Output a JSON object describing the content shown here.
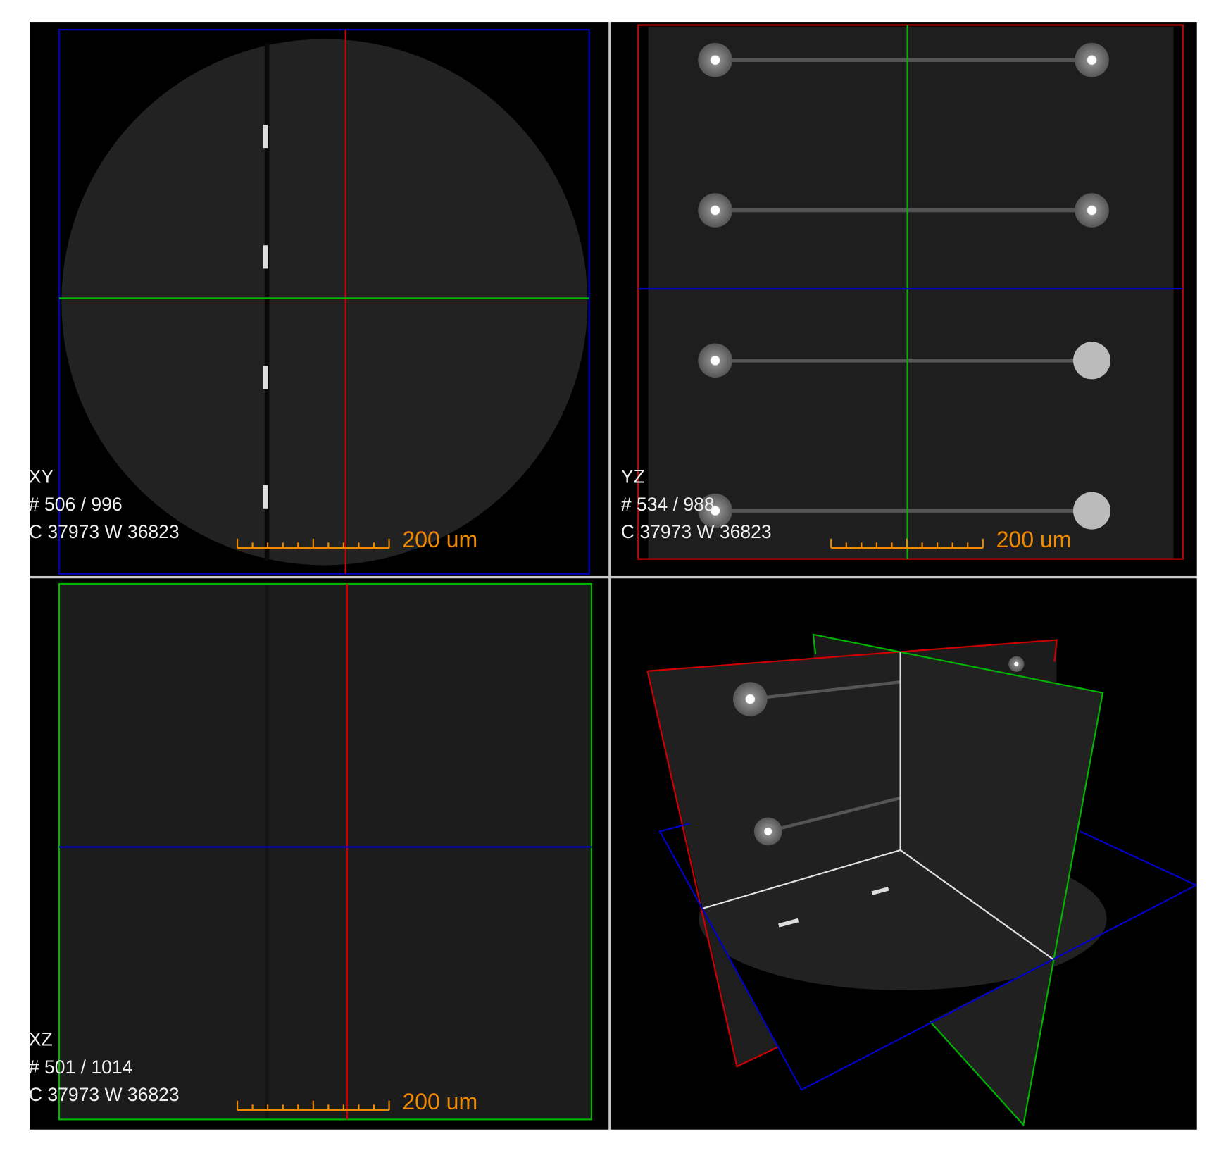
{
  "colors": {
    "x_plane": "#0000c8",
    "y_plane": "#cc0000",
    "z_plane": "#00b400",
    "scale": "#f08a00",
    "text": "#f0f0f0"
  },
  "views": {
    "xy": {
      "name": "XY",
      "slice": "# 506 / 996",
      "window": "C 37973 W 36823",
      "scale": "200 um"
    },
    "yz": {
      "name": "YZ",
      "slice": "# 534 / 988",
      "window": "C 37973 W 36823",
      "scale": "200 um"
    },
    "xz": {
      "name": "XZ",
      "slice": "# 501 / 1014",
      "window": "C 37973 W 36823",
      "scale": "200 um"
    }
  }
}
